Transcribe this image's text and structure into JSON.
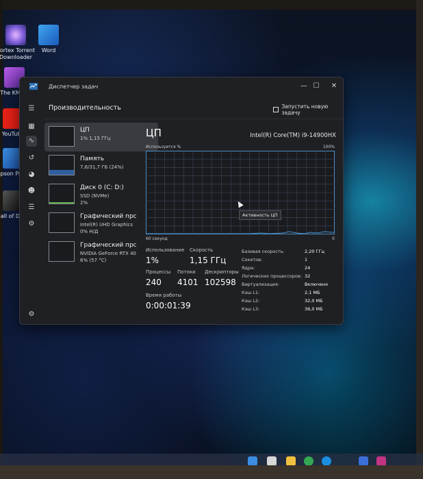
{
  "desktop": {
    "icons": [
      {
        "label": "Vortex Torrent Downloader"
      },
      {
        "label": "Word"
      },
      {
        "label": "The KMPla"
      },
      {
        "label": "YouTube"
      },
      {
        "label": "pson Prin"
      },
      {
        "label": "all of Dut"
      }
    ]
  },
  "window": {
    "title": "Диспетчер задач",
    "header_title": "Производительность",
    "run_task_label": "Запустить новую задачу",
    "more_label": "•••"
  },
  "perf_list": [
    {
      "name": "ЦП",
      "line1": "1% 1,15 ГГц",
      "line2": ""
    },
    {
      "name": "Память",
      "line1": "7,6/31,7 ГБ (24%)",
      "line2": ""
    },
    {
      "name": "Диск 0 (C: D:)",
      "line1": "SSD (NVMe)",
      "line2": "2%"
    },
    {
      "name": "Графический прс",
      "line1": "Intel(R) UHD Graphics",
      "line2": "0% Н/Д"
    },
    {
      "name": "Графический прс",
      "line1": "NVIDIA GeForce RTX 40",
      "line2": "6% (57 °C)"
    }
  ],
  "cpu": {
    "title": "ЦП",
    "model": "Intel(R) Core(TM) i9-14900HX",
    "graph_top_left": "Используется %",
    "graph_top_right": "100%",
    "graph_bottom_left": "60 секунд",
    "graph_bottom_right": "0",
    "tooltip": "Активность ЦП",
    "utilization_label": "Использование",
    "utilization_value": "1%",
    "speed_label": "Скорость",
    "speed_value": "1,15 ГГц",
    "processes_label": "Процессы",
    "processes_value": "240",
    "threads_label": "Потоки",
    "threads_value": "4101",
    "handles_label": "Дескрипторы",
    "handles_value": "102598",
    "uptime_label": "Время работы",
    "uptime_value": "0:00:01:39",
    "specs": [
      {
        "k": "Базовая скорость:",
        "v": "2,20 ГГц"
      },
      {
        "k": "Сокетов:",
        "v": "1"
      },
      {
        "k": "Ядра:",
        "v": "24"
      },
      {
        "k": "Логических процессоров:",
        "v": "32"
      },
      {
        "k": "Виртуализация:",
        "v": "Включено"
      },
      {
        "k": "Кэш L1:",
        "v": "2,1 МБ"
      },
      {
        "k": "Кэш L2:",
        "v": "32,0 МБ"
      },
      {
        "k": "Кэш L3:",
        "v": "36,0 МБ"
      }
    ]
  },
  "colors": {
    "cpu_accent": "#4a90c8",
    "memory_accent": "#3a7bd5",
    "disk_accent": "#5fb04a"
  }
}
